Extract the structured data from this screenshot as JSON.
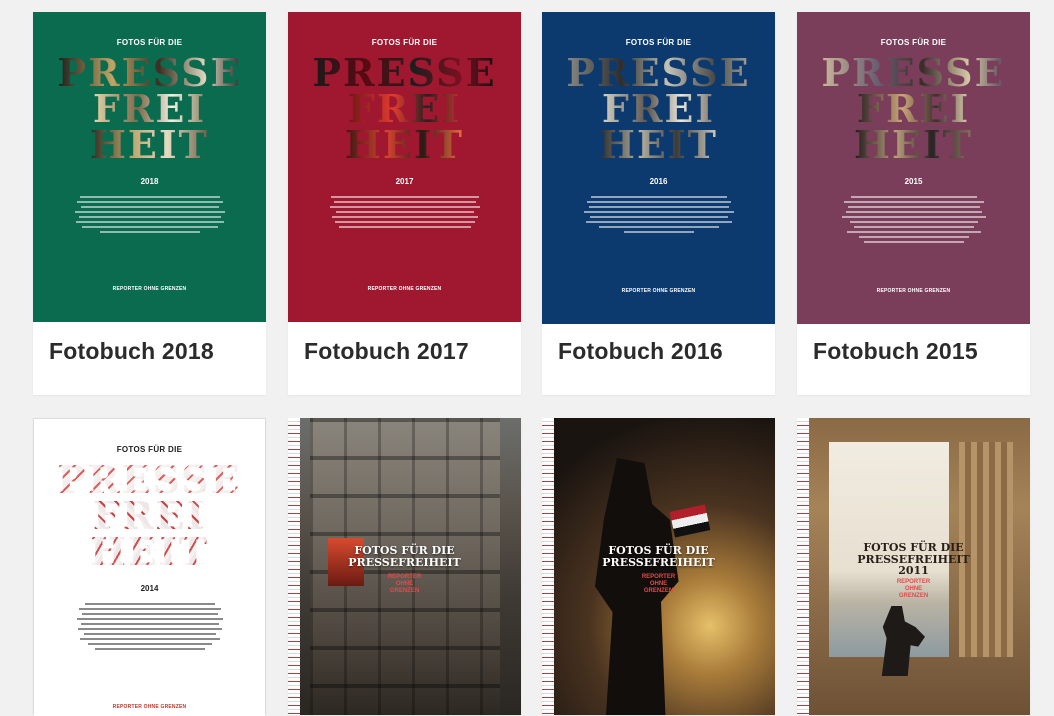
{
  "books": [
    {
      "label": "Fotobuch 2018",
      "year": "2018",
      "cover_bg": "#0a6b4f",
      "cover_top": "FOTOS FÜR DIE",
      "cover_lines": [
        "PRESSE",
        "FREI",
        "HEIT"
      ],
      "cover_footer": "REPORTER OHNE GRENZEN"
    },
    {
      "label": "Fotobuch 2017",
      "year": "2017",
      "cover_bg": "#9f1830",
      "cover_top": "FOTOS FÜR DIE",
      "cover_lines": [
        "PRESSE",
        "FREI",
        "HEIT"
      ],
      "cover_footer": "REPORTER OHNE GRENZEN"
    },
    {
      "label": "Fotobuch 2016",
      "year": "2016",
      "cover_bg": "#0c3a6f",
      "cover_top": "FOTOS FÜR DIE",
      "cover_lines": [
        "PRESSE",
        "FREI",
        "HEIT"
      ],
      "cover_footer": "REPORTER OHNE GRENZEN"
    },
    {
      "label": "Fotobuch 2015",
      "year": "2015",
      "cover_bg": "#7a3e5a",
      "cover_top": "FOTOS FÜR DIE",
      "cover_lines": [
        "PRESSE",
        "FREI",
        "HEIT"
      ],
      "cover_footer": "REPORTER OHNE GRENZEN"
    },
    {
      "year": "2014",
      "cover_bg": "#ffffff",
      "cover_top": "FOTOS FÜR DIE",
      "cover_lines": [
        "PRESSE",
        "FREI",
        "HEIT"
      ],
      "cover_footer": "REPORTER OHNE GRENZEN"
    },
    {
      "cover_title": [
        "FOTOS FÜR DIE",
        "PRESSEFREIHEIT"
      ],
      "cover_sub": [
        "REPORTER",
        "OHNE",
        "GRENZEN"
      ]
    },
    {
      "cover_title": [
        "FOTOS FÜR DIE",
        "PRESSEFREIHEIT"
      ],
      "cover_sub": [
        "REPORTER",
        "OHNE",
        "GRENZEN"
      ]
    },
    {
      "cover_title": [
        "FOTOS FÜR DIE",
        "PRESSEFREIHEIT",
        "2011"
      ],
      "cover_sub": [
        "REPORTER",
        "OHNE",
        "GRENZEN"
      ]
    }
  ],
  "colors": {
    "page_bg": "#f1f1f1",
    "label_text": "#2b2b2b",
    "accent_red": "#e34a4a"
  }
}
